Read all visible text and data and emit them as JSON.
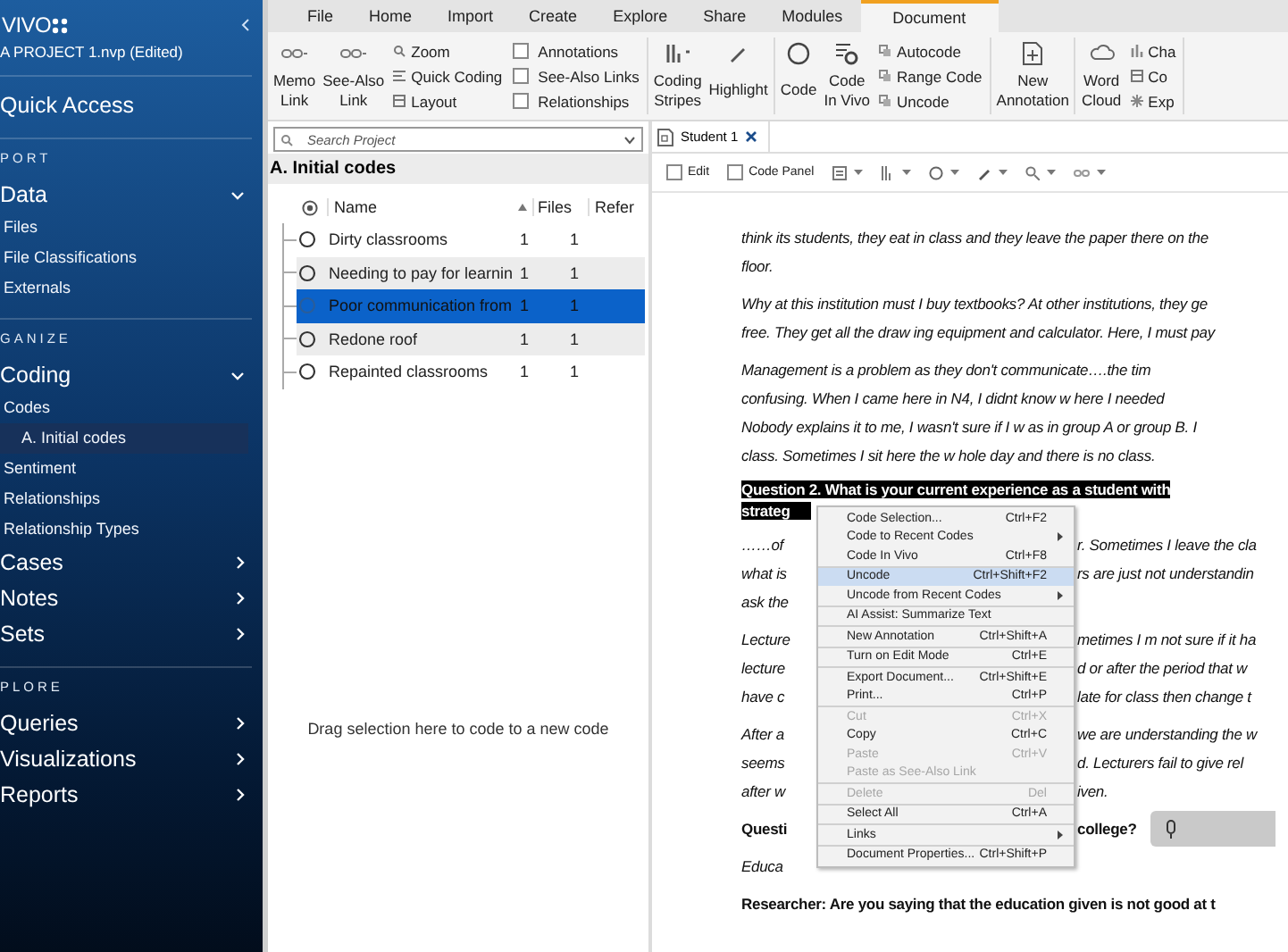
{
  "sidebar": {
    "logo": "VIVO",
    "project": "A PROJECT 1.nvp (Edited)",
    "quick_access": "Quick Access",
    "sections": [
      {
        "label": "PORT",
        "groups": [
          {
            "label": "Data",
            "expanded": true,
            "items": [
              {
                "label": "Files",
                "selected": false
              },
              {
                "label": "File Classifications",
                "selected": false
              },
              {
                "label": "Externals",
                "selected": false
              }
            ]
          }
        ]
      },
      {
        "label": "GANIZE",
        "groups": [
          {
            "label": "Coding",
            "expanded": true,
            "items": [
              {
                "label": "Codes",
                "selected": false,
                "children": [
                  {
                    "label": "A. Initial codes",
                    "selected": true
                  }
                ]
              },
              {
                "label": "Sentiment",
                "selected": false
              },
              {
                "label": "Relationships",
                "selected": false
              },
              {
                "label": "Relationship Types",
                "selected": false
              }
            ]
          },
          {
            "label": "Cases",
            "expanded": false
          },
          {
            "label": "Notes",
            "expanded": false
          },
          {
            "label": "Sets",
            "expanded": false
          }
        ]
      },
      {
        "label": "PLORE",
        "groups": [
          {
            "label": "Queries",
            "expanded": false
          },
          {
            "label": "Visualizations",
            "expanded": false
          },
          {
            "label": "Reports",
            "expanded": false
          }
        ]
      }
    ]
  },
  "ribbon": {
    "tabs": [
      {
        "label": "File",
        "selected": false
      },
      {
        "label": "Home",
        "selected": false
      },
      {
        "label": "Import",
        "selected": false
      },
      {
        "label": "Create",
        "selected": false
      },
      {
        "label": "Explore",
        "selected": false
      },
      {
        "label": "Share",
        "selected": false
      },
      {
        "label": "Modules",
        "selected": false
      },
      {
        "label": "Document",
        "selected": true
      }
    ],
    "sections": [
      {
        "groups": [
          {
            "kind": "large",
            "items": [
              "Memo\nLink",
              "See-Also\nLink"
            ]
          },
          {
            "kind": "small",
            "items": [
              "Zoom",
              "Quick Coding",
              "Layout"
            ]
          },
          {
            "kind": "checks",
            "items": [
              {
                "label": "Annotations",
                "checked": false
              },
              {
                "label": "See-Also Links",
                "checked": false
              },
              {
                "label": "Relationships",
                "checked": false
              }
            ]
          }
        ]
      },
      {
        "groups": [
          {
            "kind": "large",
            "items": [
              "Coding\nStripes",
              "Highlight"
            ]
          }
        ]
      },
      {
        "groups": [
          {
            "kind": "large",
            "items": [
              "Code",
              "Code\nIn Vivo"
            ]
          },
          {
            "kind": "small",
            "items": [
              "Autocode",
              "Range Code",
              "Uncode"
            ]
          }
        ]
      },
      {
        "groups": [
          {
            "kind": "large",
            "items": [
              "New\nAnnotation"
            ]
          }
        ]
      },
      {
        "groups": [
          {
            "kind": "large",
            "items": [
              "Word\nCloud"
            ]
          },
          {
            "kind": "small",
            "items": [
              "Cha",
              "Co",
              "Exp"
            ]
          }
        ]
      }
    ]
  },
  "codes": {
    "search": {
      "placeholder": "Search Project"
    },
    "title": "A. Initial codes",
    "columns": [
      "Name",
      "Files",
      "Refer"
    ],
    "rows": [
      {
        "name": "Dirty classrooms",
        "files": "1",
        "references": "1",
        "selected": false
      },
      {
        "name": "Needing to pay for learnin",
        "files": "1",
        "references": "1",
        "selected": false
      },
      {
        "name": "Poor communication from",
        "files": "1",
        "references": "1",
        "selected": true
      },
      {
        "name": "Redone roof",
        "files": "1",
        "references": "1",
        "selected": false
      },
      {
        "name": "Repainted classrooms",
        "files": "1",
        "references": "1",
        "selected": false
      }
    ],
    "drop_hint": "Drag selection here to code to a new code"
  },
  "document": {
    "tab": {
      "label": "Student 1"
    },
    "toolbar": {
      "checks": [
        {
          "label": "Edit",
          "checked": false
        },
        {
          "label": "Code Panel",
          "checked": false
        }
      ]
    },
    "blocks": [
      {
        "kind": "para",
        "bold": false,
        "rows": [
          {
            "text": "think its students, they eat in class and they leave the paper there on the"
          },
          {
            "text": "floor."
          }
        ]
      },
      {
        "kind": "para",
        "bold": false,
        "rows": [
          {
            "text": "Why at this institution must I buy textbooks? At other institutions, they ge"
          },
          {
            "text": "free. They get all the draw ing equipment and calculator. Here, I must pay"
          }
        ]
      },
      {
        "kind": "para",
        "bold": false,
        "rows": [
          {
            "text": " Management is a problem as they don't communicate….the tim"
          },
          {
            "text": "confusing. When I came here in N4, I didnt know w here I needed"
          },
          {
            "text": "Nobody explains it to me, I wasn't sure if I w as in group A or group B. I"
          },
          {
            "text": "class. Sometimes I sit here the w hole day and there is no class."
          }
        ]
      },
      {
        "kind": "highlight",
        "bold": true,
        "rows": [
          {
            "text": "Question 2. What is your current experience as a student with"
          },
          {
            "left": "strateg"
          }
        ]
      },
      {
        "kind": "para",
        "bold": false,
        "rows": [
          {
            "left": "……of",
            "right": "r. Sometimes I leave the cla"
          },
          {
            "left": "what is",
            "right": "rs are just not understandin"
          },
          {
            "left": "ask the"
          }
        ]
      },
      {
        "kind": "para",
        "bold": false,
        "rows": [
          {
            "left": "Lecture",
            "right": "metimes I m not sure if it ha"
          },
          {
            "left": "lecture",
            "right": "d or after the period that w"
          },
          {
            "left": "have c",
            "right": "late for class then change t"
          }
        ]
      },
      {
        "kind": "para",
        "bold": false,
        "rows": [
          {
            "left": "After a",
            "right": "we are understanding the w"
          },
          {
            "left": "seems",
            "right": "d. Lecturers fail to give rel"
          },
          {
            "left": "after w",
            "right": "iven."
          }
        ]
      },
      {
        "kind": "para",
        "bold": true,
        "rows": [
          {
            "left": "Questi",
            "right": "college?",
            "mic": true
          }
        ]
      },
      {
        "kind": "para",
        "bold": false,
        "rows": [
          {
            "left": "Educa"
          }
        ]
      },
      {
        "kind": "para",
        "bold": true,
        "rows": [
          {
            "text": "Researcher: Are you saying that the education given is not good at t"
          }
        ]
      }
    ],
    "context_menu": {
      "groups": [
        [
          {
            "label": "Code Selection...",
            "shortcut": "Ctrl+F2",
            "submenu": false,
            "disabled": false,
            "selected": false
          },
          {
            "label": "Code to Recent Codes",
            "submenu": true,
            "disabled": false,
            "selected": false
          },
          {
            "label": "Code In Vivo",
            "shortcut": "Ctrl+F8",
            "submenu": false,
            "disabled": false,
            "selected": false
          }
        ],
        [
          {
            "label": "Uncode",
            "shortcut": "Ctrl+Shift+F2",
            "submenu": false,
            "disabled": false,
            "selected": true
          },
          {
            "label": "Uncode from Recent Codes",
            "submenu": true,
            "disabled": false,
            "selected": false
          }
        ],
        [
          {
            "label": "AI Assist: Summarize Text",
            "submenu": false,
            "disabled": false,
            "selected": false
          }
        ],
        [
          {
            "label": "New Annotation",
            "shortcut": "Ctrl+Shift+A",
            "submenu": false,
            "disabled": false,
            "selected": false
          }
        ],
        [
          {
            "label": "Turn on Edit Mode",
            "shortcut": "Ctrl+E",
            "submenu": false,
            "disabled": false,
            "selected": false
          }
        ],
        [
          {
            "label": "Export Document...",
            "shortcut": "Ctrl+Shift+E",
            "submenu": false,
            "disabled": false,
            "selected": false
          },
          {
            "label": "Print...",
            "shortcut": "Ctrl+P",
            "submenu": false,
            "disabled": false,
            "selected": false
          }
        ],
        [
          {
            "label": "Cut",
            "shortcut": "Ctrl+X",
            "submenu": false,
            "disabled": true,
            "selected": false
          },
          {
            "label": "Copy",
            "shortcut": "Ctrl+C",
            "submenu": false,
            "disabled": false,
            "selected": false
          },
          {
            "label": "Paste",
            "shortcut": "Ctrl+V",
            "submenu": false,
            "disabled": true,
            "selected": false
          },
          {
            "label": "Paste as See-Also Link",
            "submenu": false,
            "disabled": true,
            "selected": false
          }
        ],
        [
          {
            "label": "Delete",
            "shortcut": "Del",
            "submenu": false,
            "disabled": true,
            "selected": false
          }
        ],
        [
          {
            "label": "Select All",
            "shortcut": "Ctrl+A",
            "submenu": false,
            "disabled": false,
            "selected": false
          }
        ],
        [
          {
            "label": "Links",
            "submenu": true,
            "disabled": false,
            "selected": false
          }
        ],
        [
          {
            "label": "Document Properties...",
            "shortcut": "Ctrl+Shift+P",
            "submenu": false,
            "disabled": false,
            "selected": false
          }
        ]
      ]
    }
  }
}
